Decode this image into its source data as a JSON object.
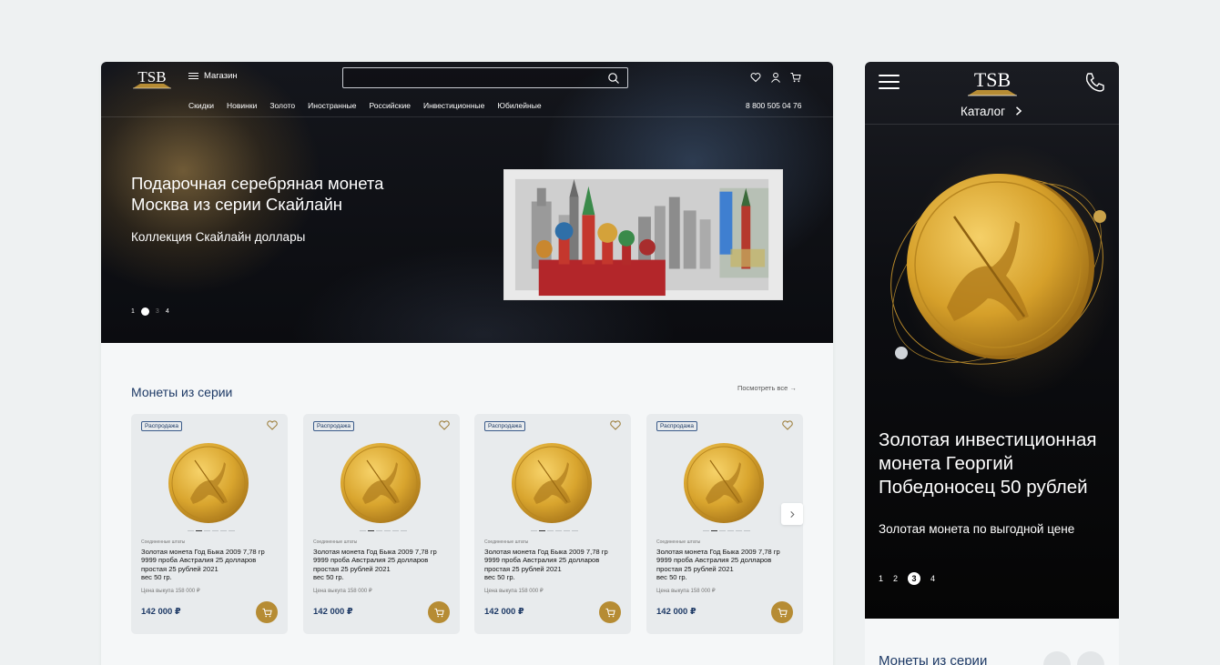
{
  "desktop": {
    "menu_label": "Магазин",
    "nav": [
      "Скидки",
      "Новинки",
      "Золото",
      "Иностранные",
      "Российские",
      "Инвестиционные",
      "Юбилейные"
    ],
    "phone": "8 800 505 04 76",
    "hero": {
      "title": "Подарочная серебряная монета Москва из серии Скайлайн",
      "subtitle": "Коллекция Скайлайн доллары",
      "pages": [
        "1",
        "2",
        "3",
        "4"
      ],
      "active_page": 2
    },
    "section_title": "Монеты из серии",
    "see_all": "Посмотреть все →",
    "products": [
      {
        "badge": "Распродажа",
        "condition": "Соединенные штаты",
        "name": "Золотая монета Год Быка 2009 7,78 гр 9999 проба Австралия 25 долларов простая 25 рублей 2021",
        "weight": "вес 50 гр.",
        "buyback": "Цена выкупа 158 000 ₽",
        "price": "142 000 ₽"
      },
      {
        "badge": "Распродажа",
        "condition": "Соединенные штаты",
        "name": "Золотая монета Год Быка 2009 7,78 гр 9999 проба Австралия 25 долларов простая 25 рублей 2021",
        "weight": "вес 50 гр.",
        "buyback": "Цена выкупа 158 000 ₽",
        "price": "142 000 ₽"
      },
      {
        "badge": "Распродажа",
        "condition": "Соединенные штаты",
        "name": "Золотая монета Год Быка 2009 7,78 гр 9999 проба Австралия 25 долларов простая 25 рублей 2021",
        "weight": "вес 50 гр.",
        "buyback": "Цена выкупа 158 000 ₽",
        "price": "142 000 ₽"
      },
      {
        "badge": "Распродажа",
        "condition": "Соединенные штаты",
        "name": "Золотая монета Год Быка 2009 7,78 гр 9999 проба Австралия 25 долларов простая 25 рублей 2021",
        "weight": "вес 50 гр.",
        "buyback": "Цена выкупа 158 000 ₽",
        "price": "142 000 ₽"
      }
    ]
  },
  "mobile": {
    "catalog": "Каталог",
    "hero": {
      "title": "Золотая инвестиционная монета Георгий Победоносец 50 рублей",
      "subtitle": "Золотая монета по выгодной цене",
      "pages": [
        "1",
        "2",
        "3",
        "4"
      ],
      "active_page": 3
    },
    "section_title": "Монеты из серии"
  },
  "brand": {
    "logo_text": "TSB",
    "gold": "#b68c34",
    "navy": "#1e3a66"
  }
}
